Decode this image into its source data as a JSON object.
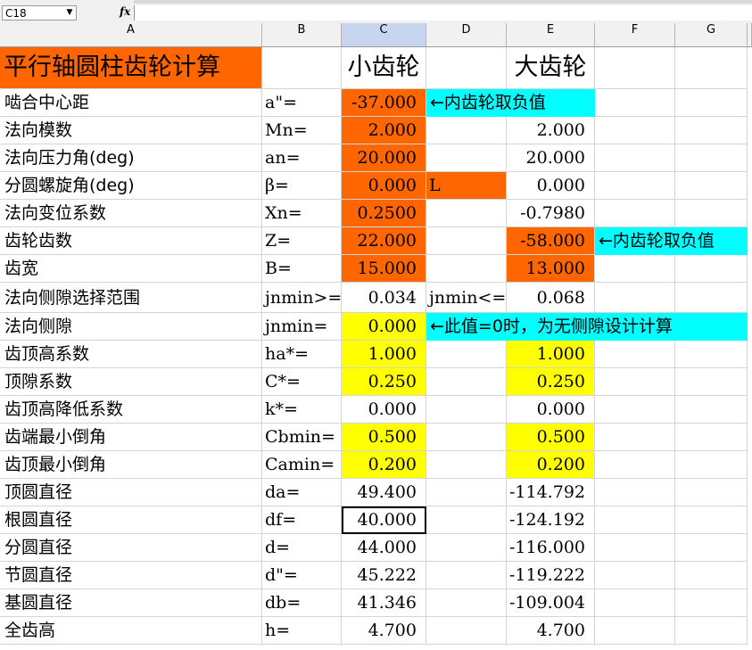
{
  "formula_bar": {
    "name_box": "C18",
    "fx": "fx"
  },
  "columns": [
    "A",
    "B",
    "C",
    "D",
    "E",
    "F",
    "G"
  ],
  "title": "平行轴圆柱齿轮计算",
  "header_small": "小齿轮",
  "header_large": "大齿轮",
  "rows": [
    {
      "label": "啮合中心距",
      "sym": "a\"=",
      "c": "-37.000",
      "d": "",
      "e": ""
    },
    {
      "label": "法向模数",
      "sym": "Mn=",
      "c": "2.000",
      "d": "",
      "e": "2.000"
    },
    {
      "label": "法向压力角(deg)",
      "sym": "an=",
      "c": "20.000",
      "d": "",
      "e": "20.000"
    },
    {
      "label": "分圆螺旋角(deg)",
      "sym": "β=",
      "c": "0.000",
      "d": "L",
      "e": "0.000"
    },
    {
      "label": "法向变位系数",
      "sym": "Xn=",
      "c": "0.2500",
      "d": "",
      "e": "-0.7980"
    },
    {
      "label": "齿轮齿数",
      "sym": "Z=",
      "c": "22.000",
      "d": "",
      "e": "-58.000"
    },
    {
      "label": "齿宽",
      "sym": "B=",
      "c": "15.000",
      "d": "",
      "e": "13.000"
    },
    {
      "label": "法向侧隙选择范围",
      "sym": "jnmin>=",
      "c": "0.034",
      "d": "jnmin<=",
      "e": "0.068"
    },
    {
      "label": "法向侧隙",
      "sym": "jnmin=",
      "c": "0.000",
      "d": "",
      "e": ""
    },
    {
      "label": "齿顶高系数",
      "sym": "ha*=",
      "c": "1.000",
      "d": "",
      "e": "1.000"
    },
    {
      "label": "顶隙系数",
      "sym": "C*=",
      "c": "0.250",
      "d": "",
      "e": "0.250"
    },
    {
      "label": "齿顶高降低系数",
      "sym": "k*=",
      "c": "0.000",
      "d": "",
      "e": "0.000"
    },
    {
      "label": "齿端最小倒角",
      "sym": "Cbmin=",
      "c": "0.500",
      "d": "",
      "e": "0.500"
    },
    {
      "label": "齿顶最小倒角",
      "sym": "Camin=",
      "c": "0.200",
      "d": "",
      "e": "0.200"
    },
    {
      "label": "顶圆直径",
      "sym": "da=",
      "c": "49.400",
      "d": "",
      "e": "-114.792"
    },
    {
      "label": "根圆直径",
      "sym": "df=",
      "c": "40.000",
      "d": "",
      "e": "-124.192"
    },
    {
      "label": "分圆直径",
      "sym": "d=",
      "c": "44.000",
      "d": "",
      "e": "-116.000"
    },
    {
      "label": "节圆直径",
      "sym": "d\"=",
      "c": "45.222",
      "d": "",
      "e": "-119.222"
    },
    {
      "label": "基圆直径",
      "sym": "db=",
      "c": "41.346",
      "d": "",
      "e": "-109.004"
    },
    {
      "label": "全齿高",
      "sym": "h=",
      "c": "4.700",
      "d": "",
      "e": "4.700"
    }
  ],
  "notes": {
    "internal_center": "←内齿轮取负值",
    "internal_teeth": "←内齿轮取负值",
    "backlash_zero": "←此值=0时，为无侧隙设计计算"
  },
  "colors": {
    "input_orange": "#ff6600",
    "input_yellow": "#ffff00",
    "note_cyan": "#00ffff"
  }
}
